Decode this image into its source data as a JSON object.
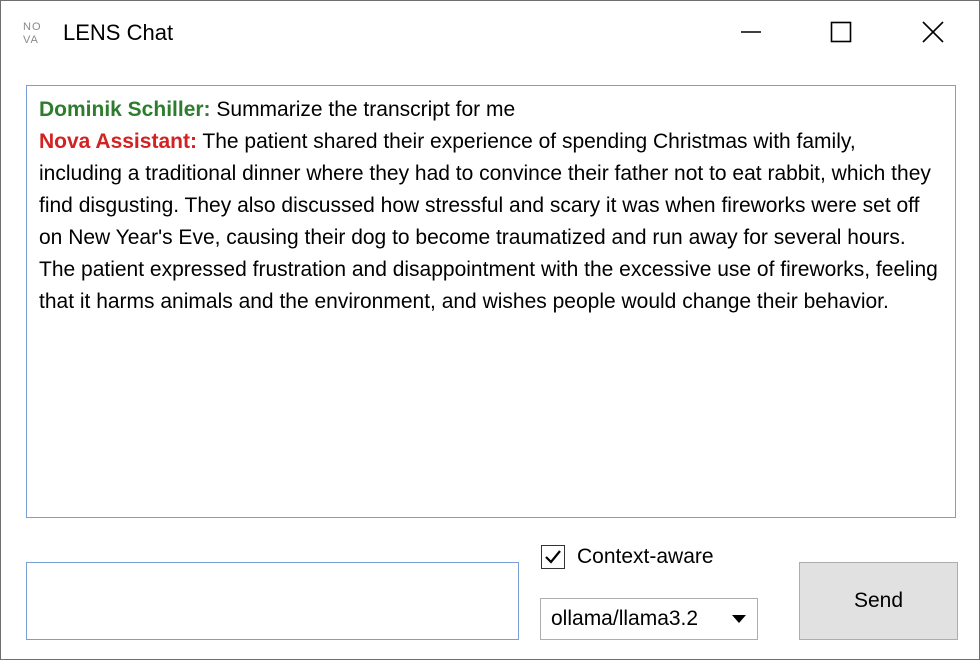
{
  "window": {
    "title": "LENS Chat",
    "logo_text": "NOVA"
  },
  "chat": {
    "messages": [
      {
        "speaker": "Dominik Schiller:",
        "role": "user",
        "text": " Summarize the transcript for me"
      },
      {
        "speaker": "Nova Assistant:",
        "role": "assistant",
        "text": " The patient shared their experience of spending Christmas with family, including a traditional dinner where they had to convince their father not to eat rabbit, which they find disgusting. They also discussed how stressful and scary it was when fireworks were set off on New Year's Eve, causing their dog to become traumatized and run away for several hours. The patient expressed frustration and disappointment with the excessive use of fireworks, feeling that it harms animals and the environment, and wishes people would change their behavior."
      }
    ]
  },
  "composer": {
    "input_value": "",
    "context_aware_label": "Context-aware",
    "context_aware_checked": true,
    "model_selected": "ollama/llama3.2",
    "send_label": "Send"
  },
  "colors": {
    "user_speaker": "#2e7d2e",
    "assistant_speaker": "#d32222",
    "field_border": "#7a9fd6",
    "button_bg": "#e1e1e1"
  },
  "icons": {
    "minimize": "minimize-icon",
    "maximize": "maximize-icon",
    "close": "close-icon",
    "dropdown": "chevron-down-icon",
    "check": "checkmark-icon"
  }
}
